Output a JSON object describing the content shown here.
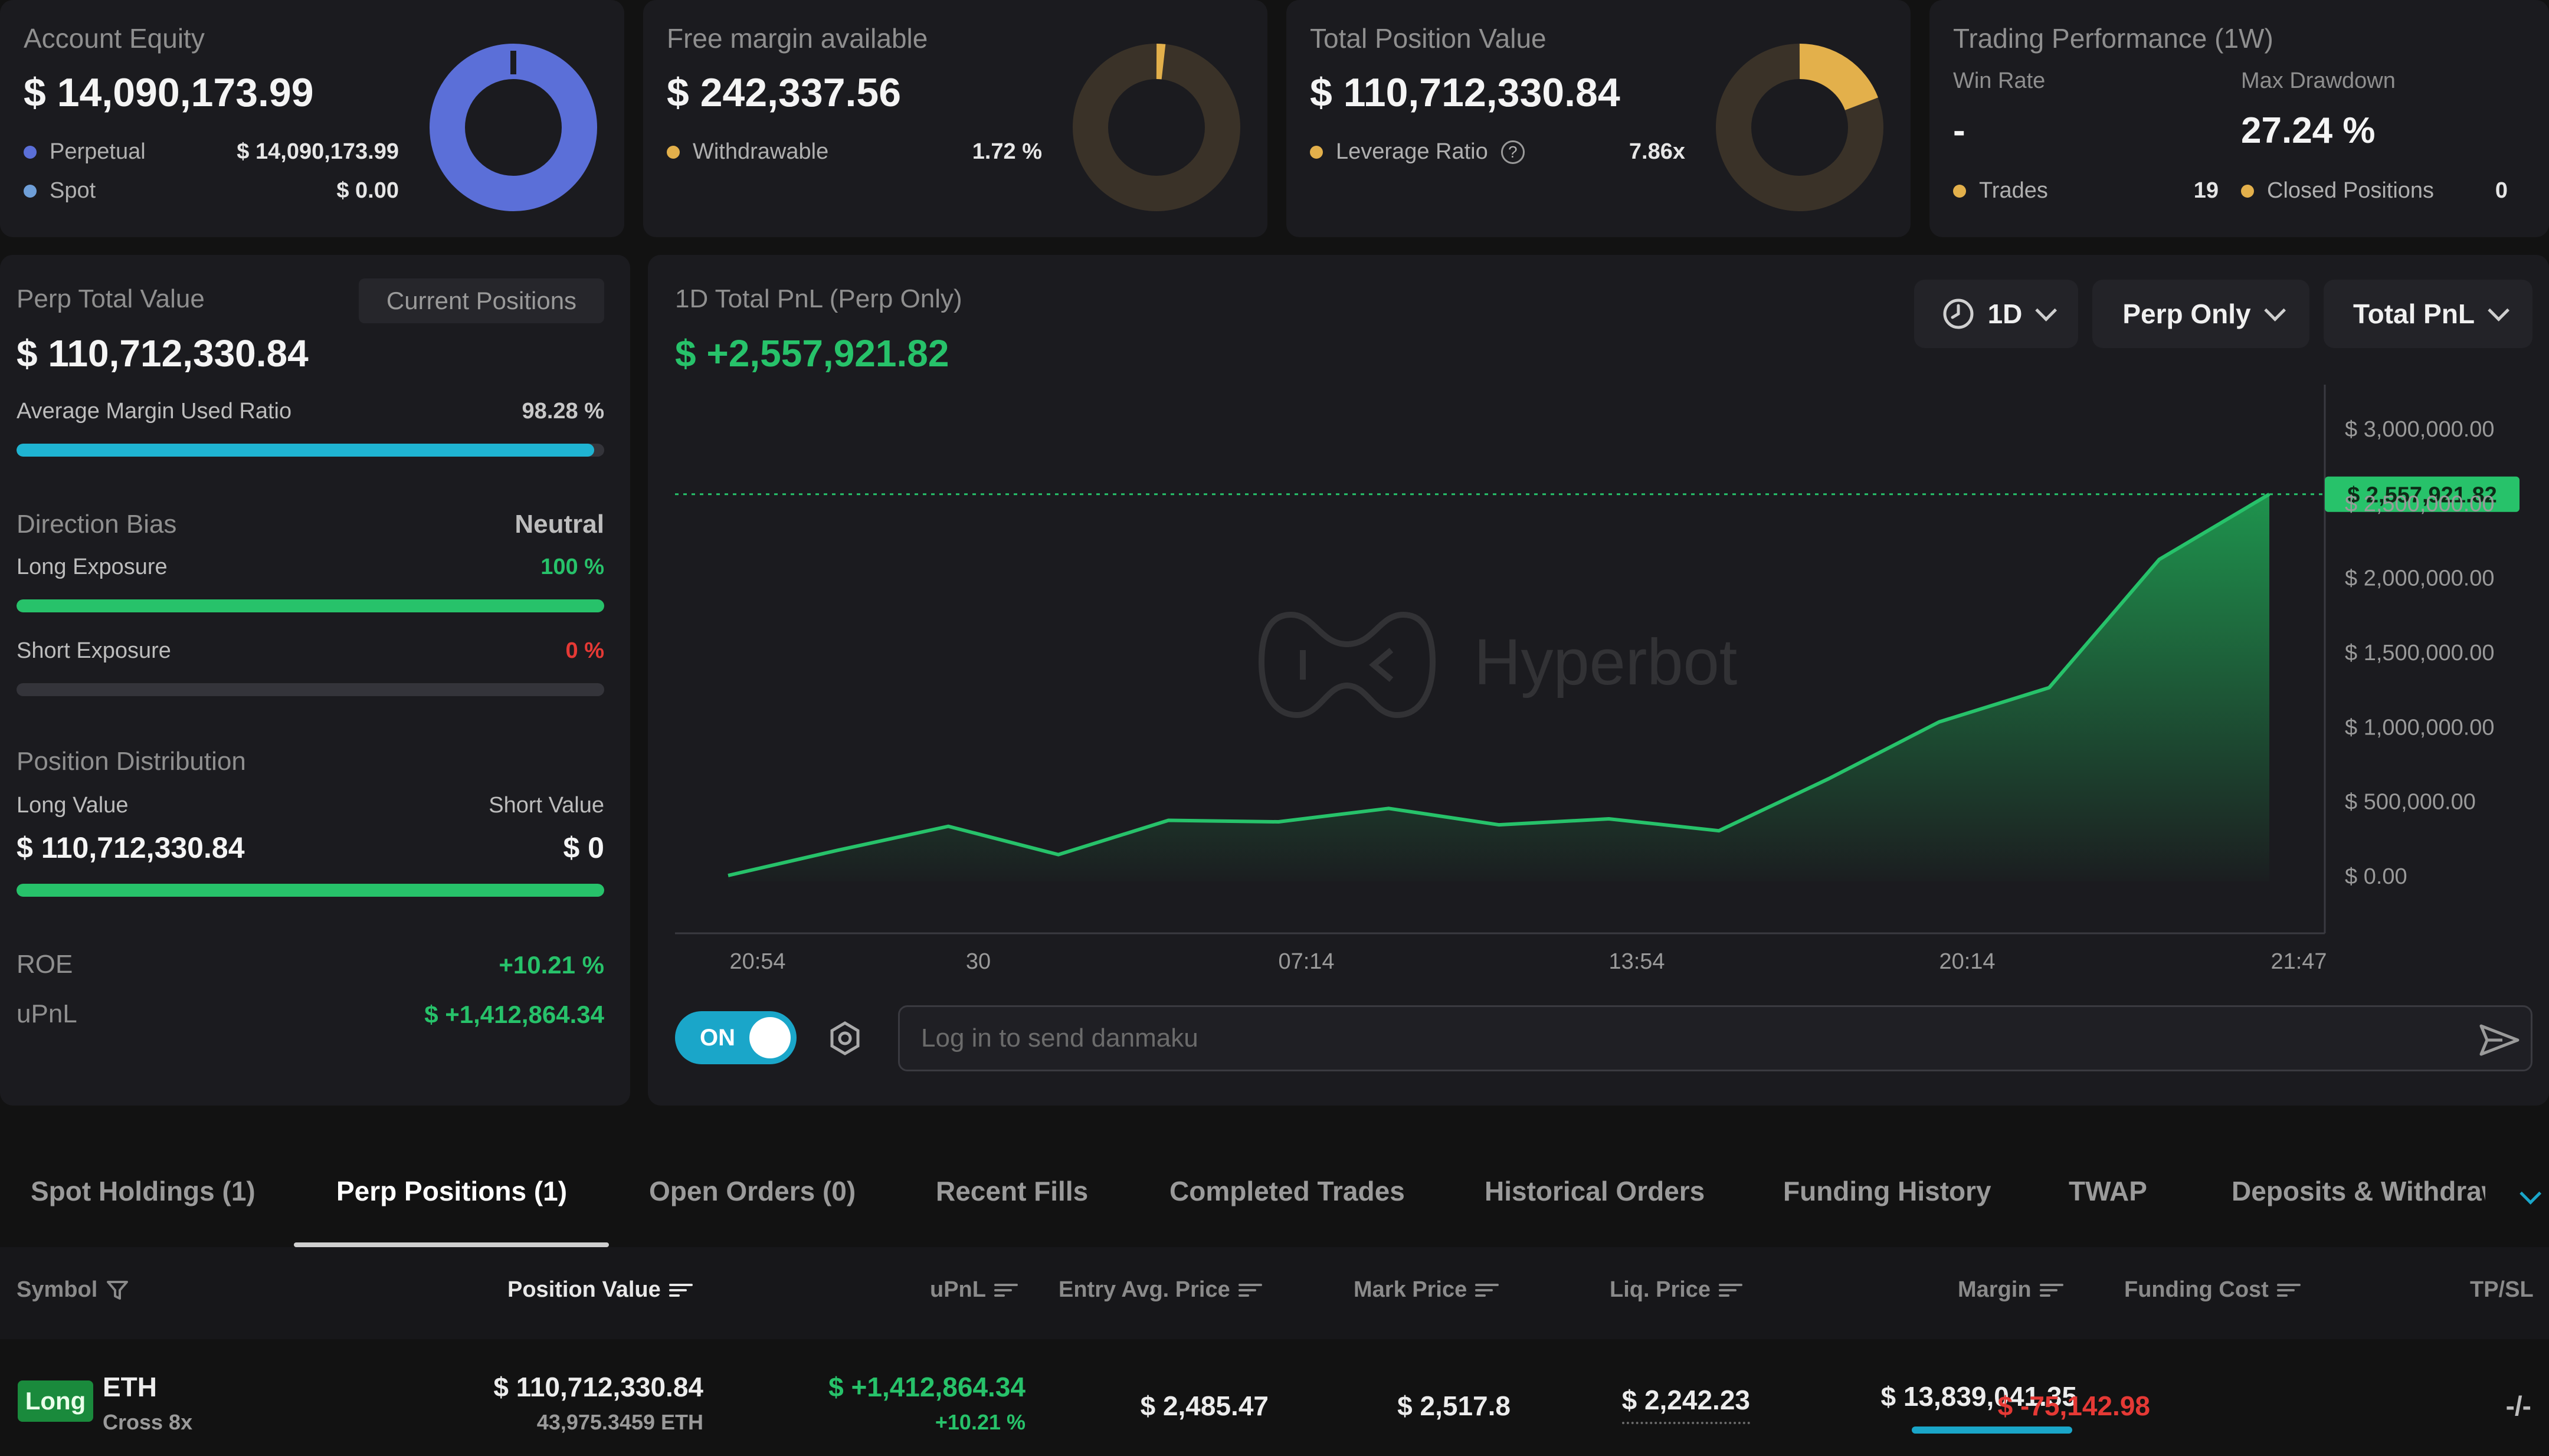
{
  "summary": {
    "equity": {
      "title": "Account Equity",
      "value": "$ 14,090,173.99",
      "perp_label": "Perpetual",
      "perp_value": "$ 14,090,173.99",
      "spot_label": "Spot",
      "spot_value": "$ 0.00",
      "ring_color": "#5b6fd8"
    },
    "margin": {
      "title": "Free margin available",
      "value": "$ 242,337.56",
      "withdraw_label": "Withdrawable",
      "withdraw_value": "1.72 %",
      "ring_color": "#e3b04b"
    },
    "position": {
      "title": "Total Position Value",
      "value": "$ 110,712,330.84",
      "leverage_label": "Leverage Ratio",
      "leverage_value": "7.86x",
      "ring_color": "#e3b04b"
    },
    "performance": {
      "title": "Trading Performance (1W)",
      "win_rate_label": "Win Rate",
      "win_rate_value": "-",
      "drawdown_label": "Max Drawdown",
      "drawdown_value": "27.24 %",
      "trades_label": "Trades",
      "trades_value": "19",
      "closed_label": "Closed Positions",
      "closed_value": "0"
    }
  },
  "perp_panel": {
    "title": "Perp Total Value",
    "current_positions_label": "Current Positions",
    "value": "$ 110,712,330.84",
    "margin_ratio_label": "Average Margin Used Ratio",
    "margin_ratio_value": "98.28 %",
    "margin_ratio_fraction": 0.9828,
    "direction_label": "Direction Bias",
    "direction_value": "Neutral",
    "long_label": "Long Exposure",
    "long_value": "100 %",
    "long_fraction": 1.0,
    "short_label": "Short Exposure",
    "short_value": "0 %",
    "short_fraction": 0,
    "distribution_label": "Position Distribution",
    "long_value_label": "Long Value",
    "short_value_label": "Short Value",
    "long_value_amount": "$ 110,712,330.84",
    "short_value_amount": "$ 0",
    "distribution_fraction": 1.0,
    "roe_label": "ROE",
    "roe_value": "+10.21 %",
    "upnl_label": "uPnL",
    "upnl_value": "$ +1,412,864.34"
  },
  "chart_panel": {
    "title": "1D Total PnL (Perp Only)",
    "value": "$ +2,557,921.82",
    "dropdowns": {
      "period": "1D",
      "scope": "Perp Only",
      "metric": "Total PnL"
    },
    "current_label": "$ 2,557,921.82",
    "watermark": "Hyperbot",
    "toggle_label": "ON",
    "danmaku_placeholder": "Log in to send danmaku"
  },
  "chart_data": {
    "type": "area",
    "x": [
      "20:54",
      "",
      "30",
      "",
      "",
      "07:14",
      "",
      "",
      "13:54",
      "",
      "",
      "20:14",
      "",
      "",
      "21:47"
    ],
    "x_ticks": [
      "20:54",
      "30",
      "07:14",
      "13:54",
      "20:14",
      "21:47"
    ],
    "series": [
      {
        "values": [
          0,
          170000,
          330000,
          140000,
          370000,
          360000,
          450000,
          340000,
          380000,
          300000,
          650000,
          1030000,
          1260000,
          2120000,
          2557921.82
        ]
      }
    ],
    "y_ticks": [
      "$ 3,000,000.00",
      "$ 2,500,000.00",
      "$ 2,000,000.00",
      "$ 1,500,000.00",
      "$ 1,000,000.00",
      "$ 500,000.00",
      "$ 0.00"
    ],
    "ylim": [
      0,
      3000000
    ],
    "grid": false,
    "colors": {
      "line": "#27c26a",
      "fill_top": "#1f9a50",
      "label_bg": "#27c26a"
    }
  },
  "tabs": [
    {
      "label": "Spot Holdings (1)",
      "active": false
    },
    {
      "label": "Perp Positions (1)",
      "active": true
    },
    {
      "label": "Open Orders (0)",
      "active": false
    },
    {
      "label": "Recent Fills",
      "active": false
    },
    {
      "label": "Completed Trades",
      "active": false
    },
    {
      "label": "Historical Orders",
      "active": false
    },
    {
      "label": "Funding History",
      "active": false
    },
    {
      "label": "TWAP",
      "active": false
    },
    {
      "label": "Deposits & Withdraw",
      "active": false
    }
  ],
  "table": {
    "headers": {
      "symbol": "Symbol",
      "position_value": "Position Value",
      "upnl": "uPnL",
      "entry": "Entry Avg. Price",
      "mark": "Mark Price",
      "liq": "Liq. Price",
      "margin": "Margin",
      "funding": "Funding Cost",
      "tpsl": "TP/SL"
    },
    "rows": [
      {
        "side": "Long",
        "symbol": "ETH",
        "mode": "Cross 8x",
        "position_value": "$ 110,712,330.84",
        "position_size": "43,975.3459 ETH",
        "upnl": "$ +1,412,864.34",
        "upnl_pct": "+10.21 %",
        "entry": "$ 2,485.47",
        "mark": "$ 2,517.8",
        "liq": "$ 2,242.23",
        "margin": "$ 13,839,041.35",
        "funding": "$ -75,142.98",
        "tpsl": "-/-"
      }
    ]
  }
}
